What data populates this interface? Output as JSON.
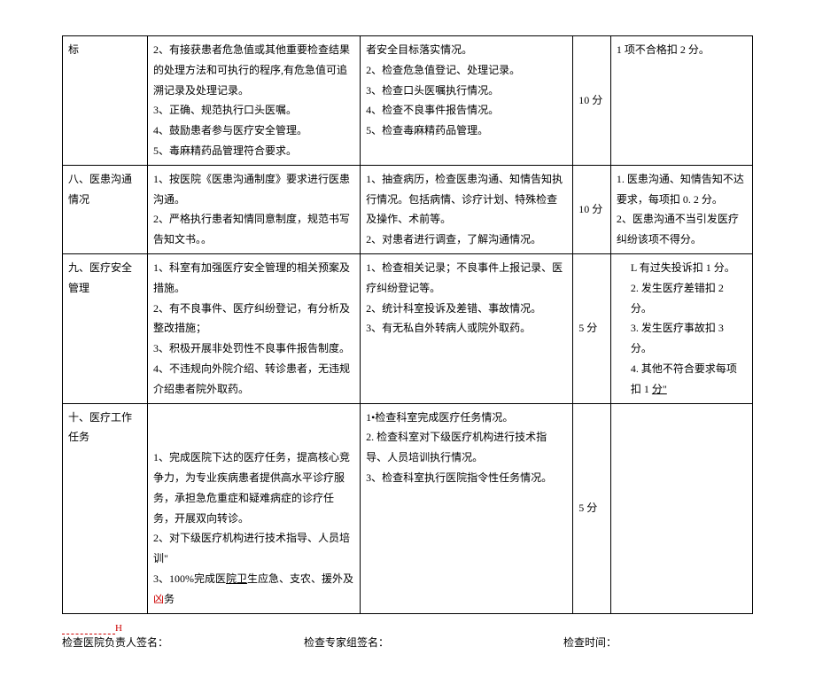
{
  "rows": [
    {
      "c1": "标",
      "c2_lines": [
        "2、有接获患者危急值或其他重要检查结果的处理方法和可执行的程序,有危急值可追溯记录及处理记录。",
        "3、正确、规范执行口头医嘱。",
        "4、鼓励患者参与医疗安全管理。",
        "5、毒麻精药品管理符合要求。"
      ],
      "c3_lines": [
        "者安全目标落实情况。",
        "2、检查危急值登记、处理记录。",
        "3、检查口头医嘱执行情况。",
        "4、检查不良事件报告情况。",
        "5、检查毒麻精药品管理。"
      ],
      "c4": "10 分",
      "c5_lines": [
        "1 项不合格扣 2 分。"
      ]
    },
    {
      "c1": "八、医患沟通情况",
      "c2_lines": [
        "1、按医院《医患沟通制度》要求进行医患沟通。",
        "2、严格执行患者知情同意制度，规范书写告知文书。。"
      ],
      "c3_lines": [
        "1、抽查病历，检查医患沟通、知情告知执行情况。包括病情、诊疗计划、特殊检查及操作、术前等。",
        "2、对患者进行调查，了解沟通情况。"
      ],
      "c4": "10 分",
      "c5_lines": [
        "1. 医患沟通、知情告知不达要求，每项扣 0. 2 分。",
        "2、医患沟通不当引发医疗纠纷该项不得分。"
      ]
    },
    {
      "c1": "九、医疗安全管理",
      "c2_lines": [
        "1、科室有加强医疗安全管理的相关预案及措施。",
        "2、有不良事件、医疗纠纷登记，有分析及整改措施；",
        "3、积极开展非处罚性不良事件报告制度。",
        "4、不违规向外院介绍、转诊患者，无违规介绍患者院外取药。"
      ],
      "c3_lines": [
        "1、检查相关记录；不良事件上报记录、医疗纠纷登记等。",
        "2、统计科室投诉及差错、事故情况。",
        "3、有无私自外转病人或院外取药。"
      ],
      "c4": "5 分",
      "c5_lines": [
        "L 有过失投诉扣 1 分。",
        "2. 发生医疗差错扣 2 分。",
        "3. 发生医疗事故扣 3 分。",
        "4. 其他不符合要求每项扣 1 <u>分\"</u>"
      ],
      "c5_indent": true
    },
    {
      "c1": "十、医疗工作任务",
      "c2_lines": [
        "",
        "",
        "1、完成医院下达的医疗任务，提高核心竞争力，为专业疾病患者提供高水平诊疗服务，承担急危重症和疑难病症的诊疗任务，开展双向转诊。",
        "2、对下级医疗机构进行技术指导、人员培训\"",
        "3、100%完成医<span class=\"underline\">院卫</span>生应急、支农、援外及<span class=\"red\">凶</span>务"
      ],
      "c3_lines": [
        "1•检查科室完成医疗任务情况。",
        "2. 检查科室对下级医疗机构进行技术指导、人员培训执行情况。",
        "3、检查科室执行医院指令性任务情况。"
      ],
      "c4": "5 分",
      "c5_lines": [
        ""
      ]
    }
  ],
  "sig": {
    "a": "检查医院负责人签名：",
    "b": "检查专家组签名：",
    "c": "检查时间："
  }
}
